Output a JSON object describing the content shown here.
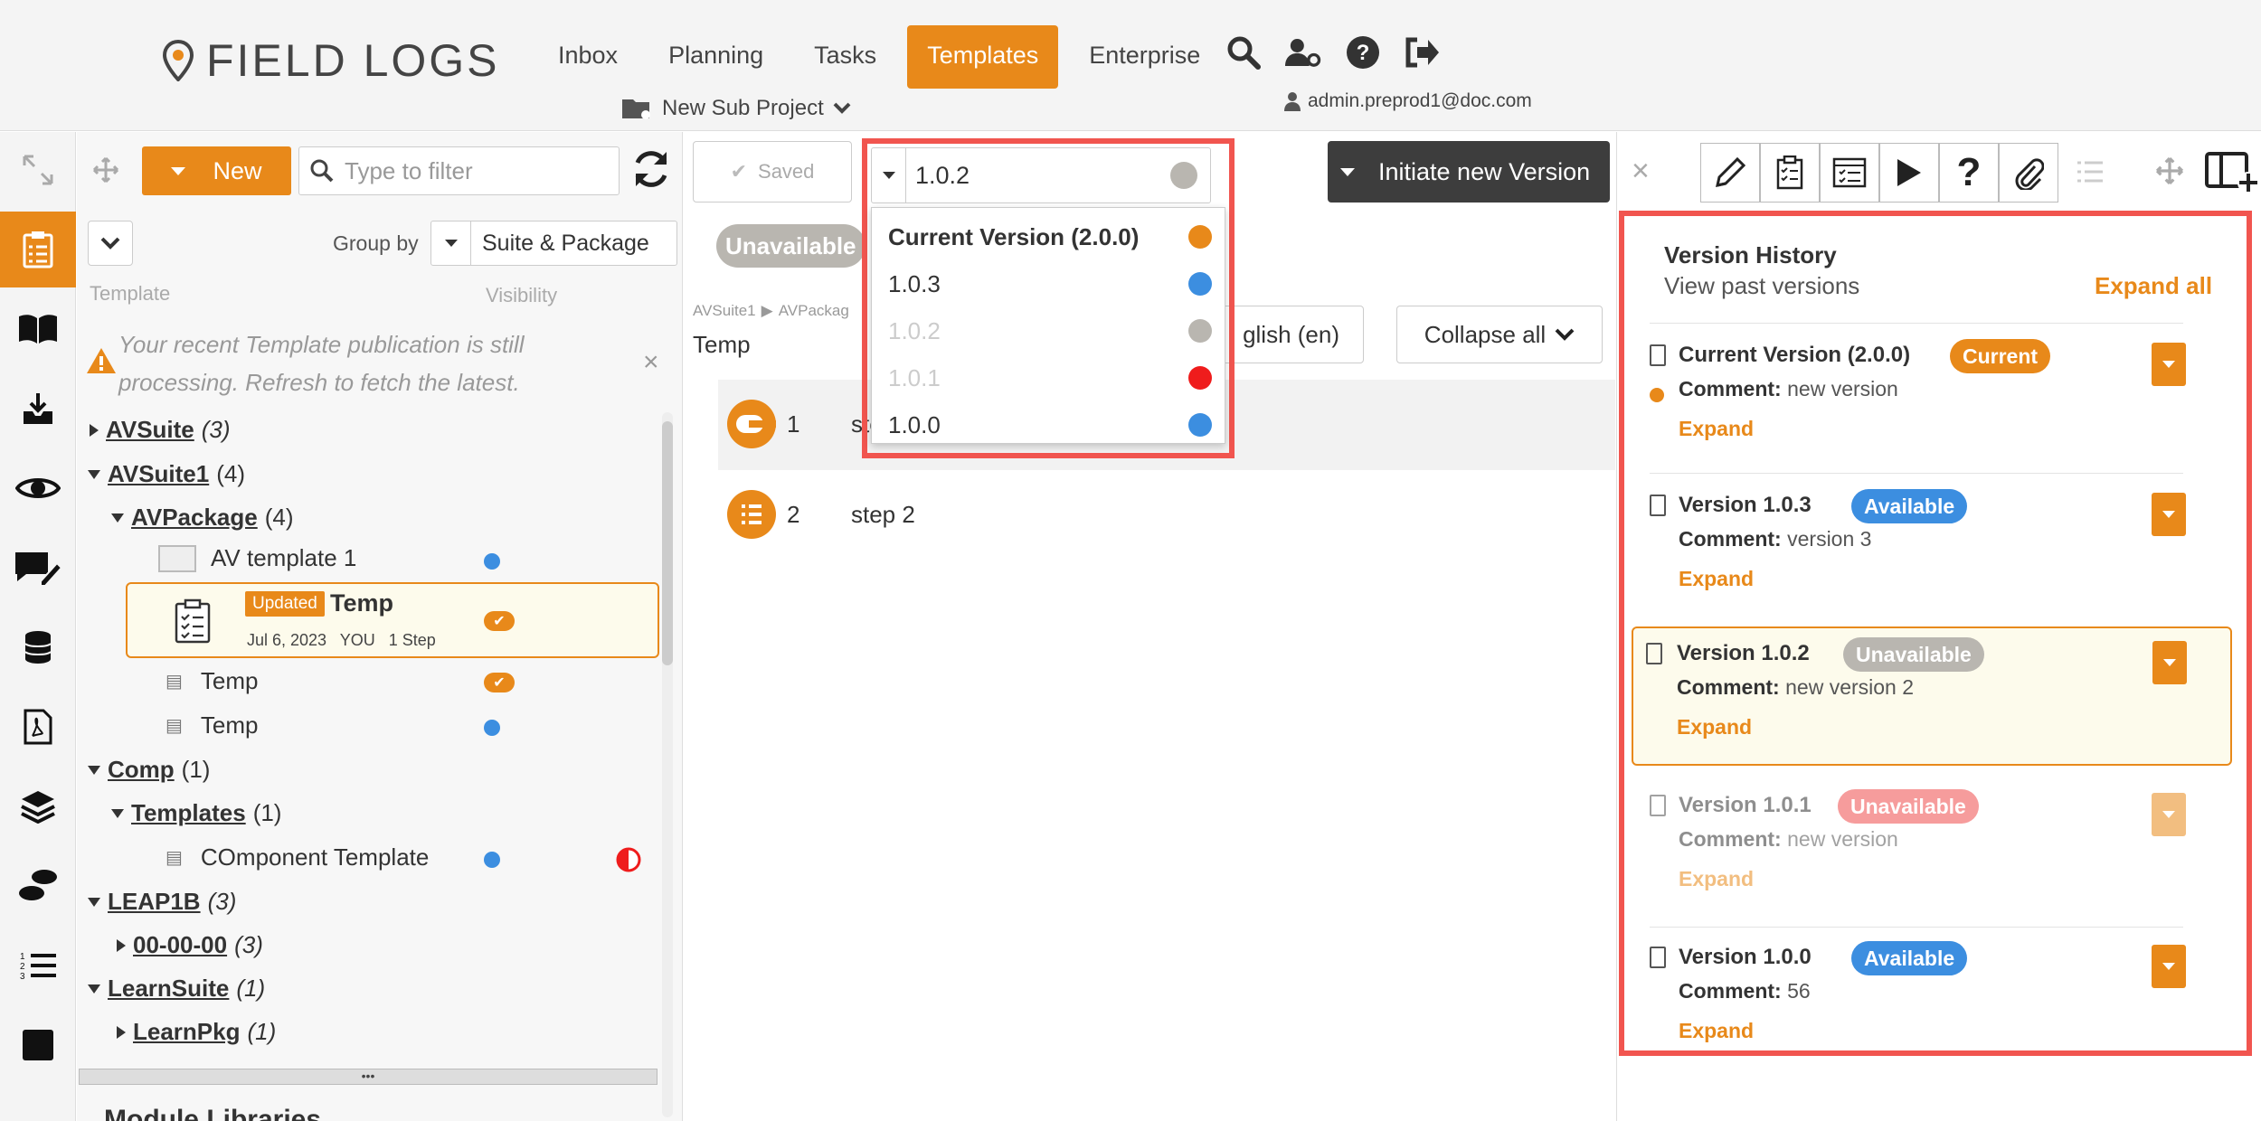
{
  "app": {
    "logo_text": "FIELD LOGS"
  },
  "nav": [
    "Inbox",
    "Planning",
    "Tasks",
    "Templates",
    "Enterprise"
  ],
  "header": {
    "sub_project": "New Sub Project",
    "user": "admin.preprod1@doc.com"
  },
  "icons": {
    "top": [
      "search-icon",
      "user-settings-icon",
      "help-icon",
      "logout-icon"
    ],
    "rail": [
      "expand-icon",
      "templates-icon",
      "book-icon",
      "inbox-tray-icon",
      "eye-icon",
      "comment-edit-icon",
      "database-icon",
      "pdf-icon",
      "layers-icon",
      "footsteps-icon",
      "numbered-list-icon",
      "stop-square-icon"
    ]
  },
  "colors": {
    "accent": "#e8891a",
    "available": "#3c8ee0",
    "unavailable_red": "#ef4c4c",
    "unavailable_gray": "#b9b6b0",
    "highlight": "#f1554f"
  },
  "tree": {
    "new_label": "New",
    "filter_placeholder": "Type to filter",
    "group_by_label": "Group by",
    "group_by_value": "Suite & Package",
    "col_template": "Template",
    "col_visibility": "Visibility",
    "warning": "Your recent Template publication is still processing. Refresh to fetch the latest.",
    "items": {
      "avsuite": {
        "name": "AVSuite",
        "count": "(3)"
      },
      "avsuite1": {
        "name": "AVSuite1",
        "count": "(4)"
      },
      "avpackage": {
        "name": "AVPackage",
        "count": "(4)"
      },
      "av_template1": "AV template 1",
      "temp_selected": {
        "badge": "Updated",
        "name": "Temp",
        "meta": "Jul 6, 2023   YOU   1 Step"
      },
      "temp2": "Temp",
      "temp3": "Temp",
      "comp": {
        "name": "Comp",
        "count": "(1)"
      },
      "templates": {
        "name": "Templates",
        "count": "(1)"
      },
      "component_template": "COmponent Template",
      "leap1b": {
        "name": "LEAP1B",
        "count": "(3)"
      },
      "zeros": {
        "name": "00-00-00",
        "count": "(3)"
      },
      "learnsuite": {
        "name": "LearnSuite",
        "count": "(1)"
      },
      "learnpkg": {
        "name": "LearnPkg",
        "count": "(1)"
      }
    },
    "module_libraries": "Module Libraries"
  },
  "middle": {
    "saved_label": "Saved",
    "version_value": "1.0.2",
    "initiate_label": "Initiate new Version",
    "status_badge": "Unavailable",
    "breadcrumb_a": "AVSuite1",
    "breadcrumb_b": "AVPackag",
    "template_name": "Temp",
    "language": "glish (en)",
    "collapse_all": "Collapse all",
    "steps": [
      {
        "num": "1",
        "label": "step"
      },
      {
        "num": "2",
        "label": "step 2"
      }
    ],
    "dropdown_options": [
      {
        "label": "Current Version (2.0.0)",
        "color": "#e8891a"
      },
      {
        "label": "1.0.3",
        "color": "#3c8ee0"
      },
      {
        "label": "1.0.2",
        "color": "#b9b6b0"
      },
      {
        "label": "1.0.1",
        "color": "#ef1c1c"
      },
      {
        "label": "1.0.0",
        "color": "#3c8ee0"
      }
    ]
  },
  "version_history": {
    "title": "Version History",
    "subtitle": "View past versions",
    "expand_all": "Expand all",
    "comment_label": "Comment:",
    "expand_label": "Expand",
    "versions": [
      {
        "title": "Current Version (2.0.0)",
        "badge": "Current",
        "comment": "new version"
      },
      {
        "title": "Version 1.0.3",
        "badge": "Available",
        "comment": "version 3"
      },
      {
        "title": "Version 1.0.2",
        "badge": "Unavailable",
        "comment": "new version 2"
      },
      {
        "title": "Version 1.0.1",
        "badge": "Unavailable",
        "comment": "new version"
      },
      {
        "title": "Version 1.0.0",
        "badge": "Available",
        "comment": "56"
      }
    ]
  }
}
